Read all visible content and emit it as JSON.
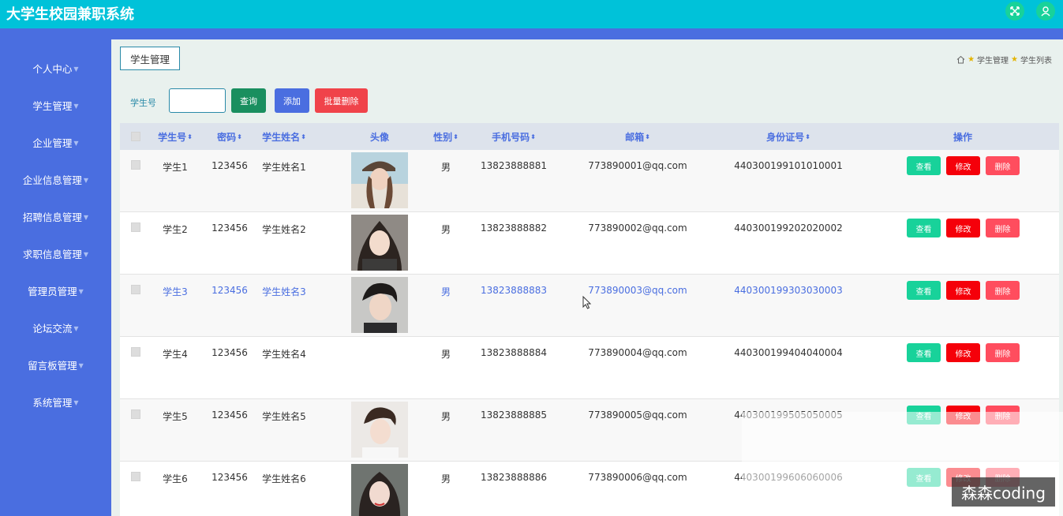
{
  "app": {
    "title": "大学生校园兼职系统"
  },
  "header_icons": {
    "expand": "expand-icon",
    "user": "user-icon"
  },
  "sidebar": {
    "items": [
      {
        "label": "个人中心"
      },
      {
        "label": "学生管理"
      },
      {
        "label": "企业管理"
      },
      {
        "label": "企业信息管理"
      },
      {
        "label": "招聘信息管理"
      },
      {
        "label": "求职信息管理"
      },
      {
        "label": "管理员管理"
      },
      {
        "label": "论坛交流"
      },
      {
        "label": "留言板管理"
      },
      {
        "label": "系统管理"
      }
    ]
  },
  "page": {
    "title": "学生管理",
    "breadcrumb": [
      "学生管理",
      "学生列表"
    ]
  },
  "search": {
    "label": "学生号",
    "value": "",
    "query_button": "查询",
    "add_button": "添加",
    "bulk_delete_button": "批量删除"
  },
  "table": {
    "headers": [
      "学生号",
      "密码",
      "学生姓名",
      "头像",
      "性别",
      "手机号码",
      "邮箱",
      "身份证号",
      "操作"
    ],
    "action_labels": {
      "view": "查看",
      "edit": "修改",
      "delete": "删除"
    },
    "rows": [
      {
        "student_no": "学生1",
        "password": "123456",
        "name": "学生姓名1",
        "has_avatar": true,
        "gender": "男",
        "phone": "13823888881",
        "email": "773890001@qq.com",
        "id_no": "440300199101010001"
      },
      {
        "student_no": "学生2",
        "password": "123456",
        "name": "学生姓名2",
        "has_avatar": true,
        "gender": "男",
        "phone": "13823888882",
        "email": "773890002@qq.com",
        "id_no": "440300199202020002"
      },
      {
        "student_no": "学生3",
        "password": "123456",
        "name": "学生姓名3",
        "has_avatar": true,
        "gender": "男",
        "phone": "13823888883",
        "email": "773890003@qq.com",
        "id_no": "440300199303030003"
      },
      {
        "student_no": "学生4",
        "password": "123456",
        "name": "学生姓名4",
        "has_avatar": false,
        "gender": "男",
        "phone": "13823888884",
        "email": "773890004@qq.com",
        "id_no": "440300199404040004"
      },
      {
        "student_no": "学生5",
        "password": "123456",
        "name": "学生姓名5",
        "has_avatar": true,
        "gender": "男",
        "phone": "13823888885",
        "email": "773890005@qq.com",
        "id_no": "440300199505050005"
      },
      {
        "student_no": "学生6",
        "password": "123456",
        "name": "学生姓名6",
        "has_avatar": true,
        "gender": "男",
        "phone": "13823888886",
        "email": "773890006@qq.com",
        "id_no": "440300199606060006"
      }
    ]
  },
  "watermark": "森森coding",
  "colors": {
    "header": "#00c2d9",
    "sidebar": "#4a6ee0",
    "accent_green": "#18d29a",
    "danger": "#f5000a"
  }
}
